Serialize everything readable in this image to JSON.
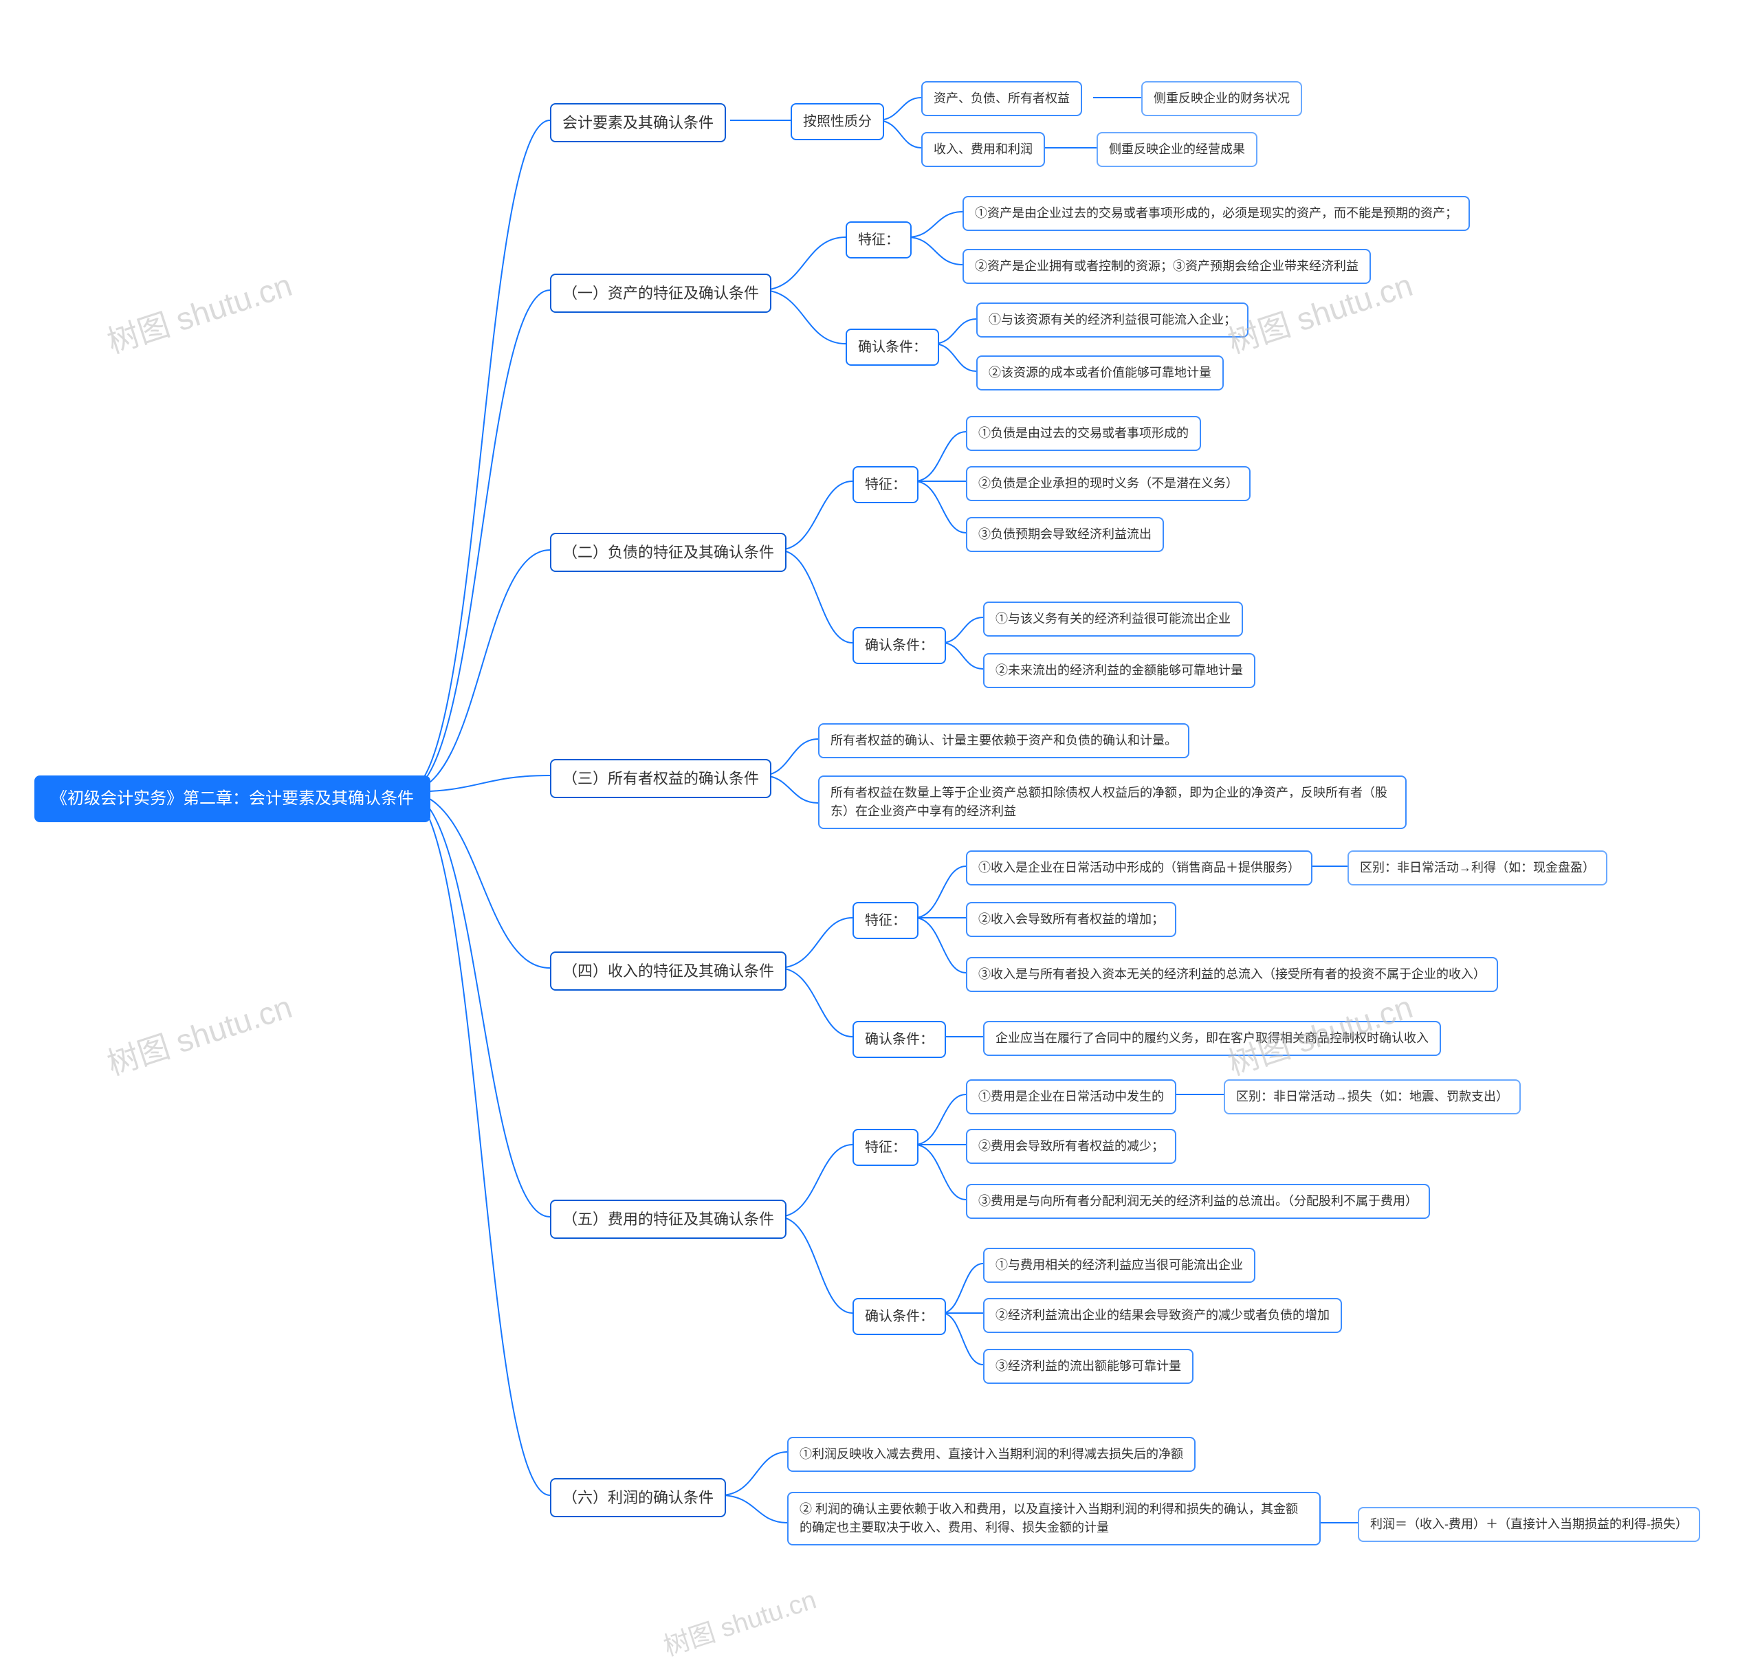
{
  "root": "《初级会计实务》第二章：会计要素及其确认条件",
  "a": {
    "title": "会计要素及其确认条件",
    "by": "按照性质分",
    "a1": "资产、负债、所有者权益",
    "a1n": "侧重反映企业的财务状况",
    "a2": "收入、费用和利润",
    "a2n": "侧重反映企业的经营成果"
  },
  "b": {
    "title": "（一）资产的特征及确认条件",
    "tz": "特征：",
    "tz1": "①资产是由企业过去的交易或者事项形成的，必须是现实的资产，而不能是预期的资产；",
    "tz2": "②资产是企业拥有或者控制的资源；③资产预期会给企业带来经济利益",
    "qr": "确认条件：",
    "qr1": "①与该资源有关的经济利益很可能流入企业；",
    "qr2": "②该资源的成本或者价值能够可靠地计量"
  },
  "c": {
    "title": "（二）负债的特征及其确认条件",
    "tz": "特征：",
    "tz1": "①负债是由过去的交易或者事项形成的",
    "tz2": "②负债是企业承担的现时义务（不是潜在义务）",
    "tz3": "③负债预期会导致经济利益流出",
    "qr": "确认条件：",
    "qr1": "①与该义务有关的经济利益很可能流出企业",
    "qr2": "②未来流出的经济利益的金额能够可靠地计量"
  },
  "d": {
    "title": "（三）所有者权益的确认条件",
    "t1": "所有者权益的确认、计量主要依赖于资产和负债的确认和计量。",
    "t2": "所有者权益在数量上等于企业资产总额扣除债权人权益后的净额，即为企业的净资产，反映所有者（股东）在企业资产中享有的经济利益"
  },
  "e": {
    "title": "（四）收入的特征及其确认条件",
    "tz": "特征：",
    "tz1": "①收入是企业在日常活动中形成的（销售商品＋提供服务）",
    "tz1n": "区别：非日常活动→利得（如：现金盘盈）",
    "tz2": "②收入会导致所有者权益的增加；",
    "tz3": "③收入是与所有者投入资本无关的经济利益的总流入（接受所有者的投资不属于企业的收入）",
    "qr": "确认条件：",
    "qr1": "企业应当在履行了合同中的履约义务，即在客户取得相关商品控制权时确认收入"
  },
  "f": {
    "title": "（五）费用的特征及其确认条件",
    "tz": "特征：",
    "tz1": "①费用是企业在日常活动中发生的",
    "tz1n": "区别：非日常活动→损失（如：地震、罚款支出）",
    "tz2": "②费用会导致所有者权益的减少；",
    "tz3": "③费用是与向所有者分配利润无关的经济利益的总流出。（分配股利不属于费用）",
    "qr": "确认条件：",
    "qr1": "①与费用相关的经济利益应当很可能流出企业",
    "qr2": "②经济利益流出企业的结果会导致资产的减少或者负债的增加",
    "qr3": "③经济利益的流出额能够可靠计量"
  },
  "g": {
    "title": "（六）利润的确认条件",
    "t1": "①利润反映收入减去费用、直接计入当期利润的利得减去损失后的净额",
    "t2": "② 利润的确认主要依赖于收入和费用，以及直接计入当期利润的利得和损失的确认，其金额的确定也主要取决于收入、费用、利得、损失金额的计量",
    "t2n": "利润＝（收入-费用）＋（直接计入当期损益的利得-损失）"
  },
  "wm": "树图 shutu.cn"
}
